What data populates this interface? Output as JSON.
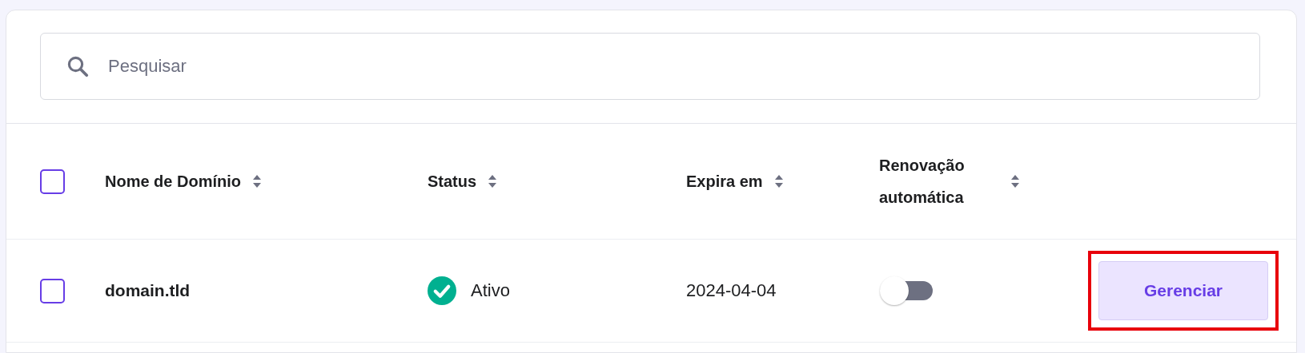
{
  "search": {
    "placeholder": "Pesquisar"
  },
  "table": {
    "select_all": {
      "checked": false
    },
    "columns": [
      {
        "label": "Nome de Domínio",
        "sortable": true
      },
      {
        "label": "Status",
        "sortable": true
      },
      {
        "label": "Expira em",
        "sortable": true
      },
      {
        "label": "Renovação automática",
        "sortable": true
      }
    ],
    "rows": [
      {
        "checked": false,
        "domain": "domain.tld",
        "status": {
          "kind": "active",
          "label": "Ativo"
        },
        "expires": "2024-04-04",
        "auto_renew": {
          "on": false
        },
        "action": {
          "label": "Gerenciar",
          "highlighted": true
        }
      }
    ]
  }
}
